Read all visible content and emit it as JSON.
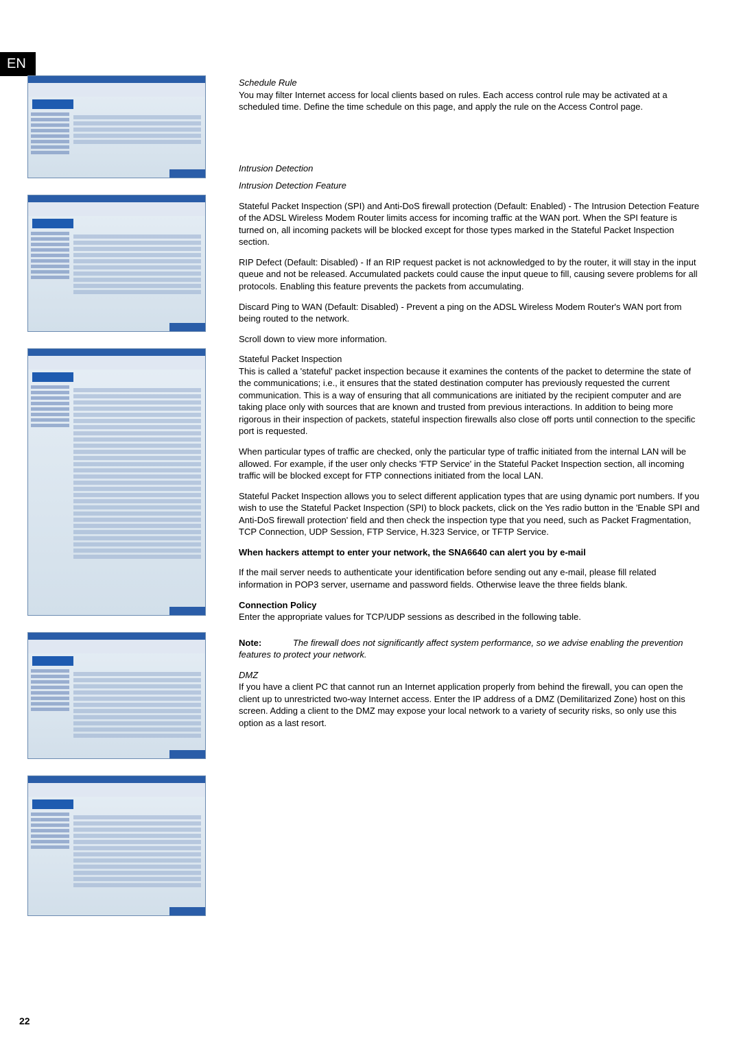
{
  "lang_badge": "EN",
  "page_number": "22",
  "sections": {
    "schedule_rule": {
      "heading": "Schedule Rule",
      "body": "You may filter Internet access for local clients based on rules. Each access control rule may be activated at a scheduled time. Define the time schedule on this page, and apply the rule on the Access Control page."
    },
    "intrusion_detection": {
      "heading": "Intrusion Detection",
      "sub_heading": "Intrusion Detection Feature",
      "p1": "Stateful Packet Inspection (SPI) and Anti-DoS firewall protection (Default: Enabled) - The Intrusion Detection Feature of the ADSL Wireless Modem Router limits access for incoming traffic at the WAN port. When the SPI feature is turned on, all incoming packets will be blocked except for those types marked in the Stateful Packet Inspection section.",
      "p2": "RIP Defect (Default: Disabled) - If an RIP request packet is not acknowledged to by the router, it will stay in the input queue and not be released. Accumulated packets could cause the input queue to fill, causing severe problems for all protocols. Enabling this feature prevents the packets from accumulating.",
      "p3": "Discard Ping to WAN (Default: Disabled) - Prevent a ping on the ADSL Wireless Modem Router's WAN port from being routed to the network.",
      "p4": "Scroll down to view more information.",
      "spi_heading": "Stateful Packet Inspection",
      "spi1": "This is called a 'stateful' packet inspection because it examines the contents of the packet to determine the state of the communications; i.e., it ensures that the stated destination computer has previously requested the current communication. This is a way of ensuring that all communications are initiated by the recipient computer and are taking place only with sources that are known and trusted from previous interactions. In addition to being more rigorous in their inspection of packets, stateful inspection firewalls also close off ports until connection to the specific port is requested.",
      "spi2": "When particular types of traffic are checked, only the particular type of traffic initiated from the internal LAN will be allowed. For example, if the user only checks 'FTP Service' in the Stateful Packet Inspection section, all incoming traffic will be blocked except for FTP connections initiated from the local LAN.",
      "spi3": "Stateful Packet Inspection allows you to select different application types that are using dynamic port numbers. If you wish to use the Stateful Packet Inspection (SPI) to block packets, click on the Yes radio button in the 'Enable SPI and Anti-DoS firewall protection' field and then check the inspection type that you need, such as Packet Fragmentation, TCP Connection, UDP Session, FTP Service, H.323 Service, or TFTP Service.",
      "alert_heading": "When hackers attempt to enter your network, the SNA6640 can alert you by e-mail",
      "alert_body": "If the mail server needs to authenticate your identification before sending out any e-mail, please fill related information in POP3 server, username and password fields. Otherwise leave the three fields blank.",
      "conn_heading": "Connection Policy",
      "conn_body": "Enter the appropriate values for TCP/UDP sessions as described in the following table.",
      "note_lead": "Note:",
      "note_body": "The firewall does not significantly affect system performance, so we advise enabling the prevention features to protect your network."
    },
    "dmz": {
      "heading": "DMZ",
      "body": "If you have a client PC that cannot run an Internet application properly from behind the firewall, you can open the client up to unrestricted two-way Internet access. Enter the IP address of a DMZ (Demilitarized Zone) host on this screen. Adding a client to the DMZ may expose your local network to a variety of security risks, so only use this option as a last resort."
    }
  }
}
